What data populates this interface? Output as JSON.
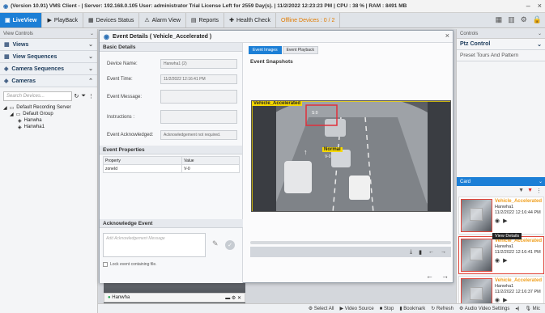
{
  "title_bar": {
    "text": "(Version 10.91) VMS Client - | Server: 192.168.0.105 User: administrator Trial License Left for 2559 Day(s). | 11/2/2022 12:23:23 PM | CPU : 38 % | RAM : 8491 MB",
    "minimize": "–",
    "close": "×"
  },
  "tabs": [
    {
      "label": "LiveView",
      "icon": "camera-icon"
    },
    {
      "label": "PlayBack",
      "icon": "play-icon"
    },
    {
      "label": "Devices Status",
      "icon": "devices-icon"
    },
    {
      "label": "Alarm View",
      "icon": "alarm-icon"
    },
    {
      "label": "Reports",
      "icon": "reports-icon"
    },
    {
      "label": "Health Check",
      "icon": "health-icon"
    },
    {
      "label": "Offline Devices : 0 / 2",
      "icon": "offline-icon"
    }
  ],
  "left_pane": {
    "header": "View Controls",
    "sections": [
      "Views",
      "View Sequences",
      "Camera Sequences",
      "Cameras"
    ],
    "search_placeholder": "Search Devices...",
    "tree": {
      "server": "Default Recording Server",
      "group": "Default Group",
      "cameras": [
        "Hanwha",
        "Hanwha1"
      ]
    }
  },
  "right_pane": {
    "header": "Controls",
    "ptz": "Ptz Control",
    "preset": "Preset Tours And Pattern",
    "alarm_header": "Card",
    "alarms": [
      {
        "title": "Vehicle_Accelerated",
        "camera": "Hanwha1",
        "time": "11/2/2022 12:16:44 PM"
      },
      {
        "title": "Vehicle_Accelerated",
        "camera": "Hanwha1",
        "time": "11/2/2022 12:16:41 PM"
      },
      {
        "title": "Vehicle_Accelerated",
        "camera": "Hanwha1",
        "time": "11/2/2022 12:16:37 PM"
      }
    ],
    "tooltip": "View Details"
  },
  "dialog": {
    "title": "Event Details ( Vehicle_Accelerated )",
    "basic_details": "Basic Details",
    "fields": {
      "device_name_label": "Device Name:",
      "device_name_value": "Hanwha1 (2)",
      "event_time_label": "Event Time:",
      "event_time_value": "11/2/2022 12:16:41 PM",
      "event_message_label": "Event Message:",
      "event_message_value": "",
      "instructions_label": "Instructions :",
      "instructions_value": "",
      "ack_label": "Event Acknowledged:",
      "ack_value": "Acknowledgement not required."
    },
    "event_properties": "Event Properties",
    "props_header": [
      "Property",
      "Value"
    ],
    "props_rows": [
      [
        "zoneId",
        "V-0"
      ]
    ],
    "acknowledge_event": "Acknowledge Event",
    "ack_placeholder": "Add Acknowledgement Message",
    "lock_label": "Lock event containing file.",
    "subtabs": [
      "Event Images",
      "Event Playback"
    ],
    "snapshots_label": "Event Snapshots",
    "overlay_title": "Vehicle_Accelerated",
    "overlay_normal": "Normal",
    "overlay_small": "S:0",
    "overlay_tag": "V-0"
  },
  "feed": {
    "name": "Hanwha"
  },
  "bottom_toolbar": [
    "Select All",
    "Video Source",
    "Stop",
    "Bookmark",
    "Refresh",
    "Audio Video Settings",
    "Mic"
  ]
}
